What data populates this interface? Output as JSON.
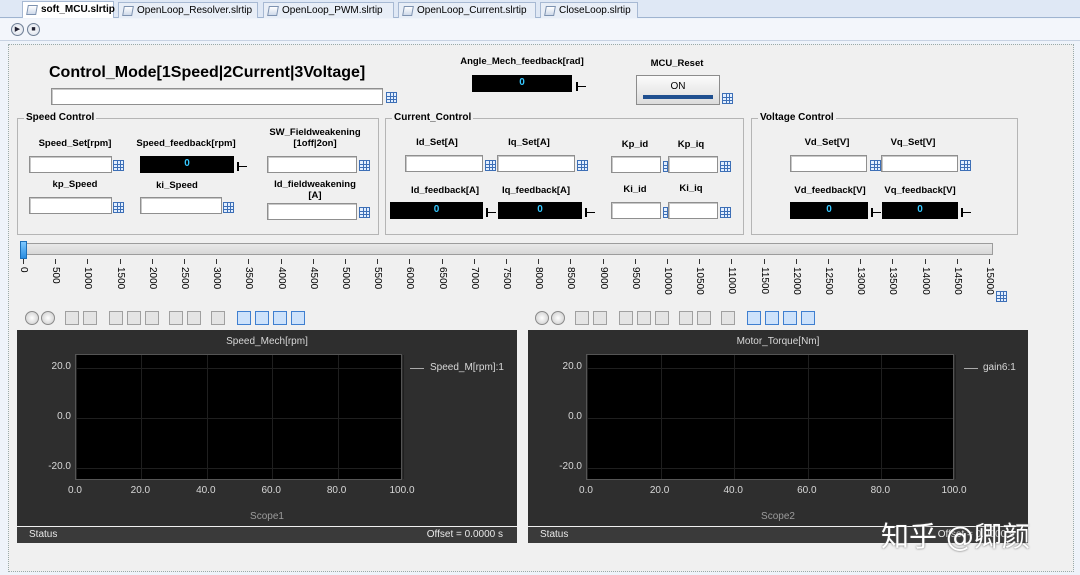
{
  "tabs": [
    {
      "label": "soft_MCU.slrtip",
      "active": true
    },
    {
      "label": "OpenLoop_Resolver.slrtip",
      "active": false
    },
    {
      "label": "OpenLoop_PWM.slrtip",
      "active": false
    },
    {
      "label": "OpenLoop_Current.slrtip",
      "active": false
    },
    {
      "label": "CloseLoop.slrtip",
      "active": false
    }
  ],
  "header": {
    "control_mode_title": "Control_Mode[1Speed|2Current|3Voltage]",
    "angle_label": "Angle_Mech_feedback[rad]",
    "angle_value": "0",
    "mcu_reset_label": "MCU_Reset",
    "mcu_reset_button": "ON"
  },
  "speed_control": {
    "title": "Speed Control",
    "speed_set_label": "Speed_Set[rpm]",
    "speed_feedback_label": "Speed_feedback[rpm]",
    "speed_feedback_value": "0",
    "sw_fieldweakening_label_1": "SW_Fieldweakening",
    "sw_fieldweakening_label_2": "[1off|2on]",
    "kp_speed_label": "kp_Speed",
    "ki_speed_label": "ki_Speed",
    "id_fieldweakening_label_1": "Id_fieldweakening",
    "id_fieldweakening_label_2": "[A]"
  },
  "current_control": {
    "title": "Current_Control",
    "id_set_label": "Id_Set[A]",
    "iq_set_label": "Iq_Set[A]",
    "kp_id_label": "Kp_id",
    "kp_iq_label": "Kp_iq",
    "id_feedback_label": "Id_feedback[A]",
    "id_feedback_value": "0",
    "iq_feedback_label": "Iq_feedback[A]",
    "iq_feedback_value": "0",
    "ki_id_label": "Ki_id",
    "ki_iq_label": "Ki_iq"
  },
  "voltage_control": {
    "title": "Voltage Control",
    "vd_set_label": "Vd_Set[V]",
    "vq_set_label": "Vq_Set[V]",
    "vd_feedback_label": "Vd_feedback[V]",
    "vd_feedback_value": "0",
    "vq_feedback_label": "Vq_feedback[V]",
    "vq_feedback_value": "0"
  },
  "slider": {
    "value": 0,
    "min": 0,
    "max": 15000,
    "tick_labels": [
      "0",
      "500",
      "1000",
      "1500",
      "2000",
      "2500",
      "3000",
      "3500",
      "4000",
      "4500",
      "5000",
      "5500",
      "6000",
      "6500",
      "7000",
      "7500",
      "8000",
      "8500",
      "9000",
      "9500",
      "10000",
      "10500",
      "11000",
      "11500",
      "12000",
      "12500",
      "13000",
      "13500",
      "14000",
      "14500",
      "15000"
    ]
  },
  "scopes": [
    {
      "title": "Speed_Mech[rpm]",
      "legend": "Speed_M[rpm]:1",
      "name": "Scope1",
      "y_ticks": [
        "20.0",
        "0.0",
        "-20.0"
      ],
      "x_ticks": [
        "0.0",
        "20.0",
        "40.0",
        "60.0",
        "80.0",
        "100.0"
      ],
      "status_label": "Status",
      "status_offset": "Offset = 0.0000 s"
    },
    {
      "title": "Motor_Torque[Nm]",
      "legend": "gain6:1",
      "name": "Scope2",
      "y_ticks": [
        "20.0",
        "0.0",
        "-20.0"
      ],
      "x_ticks": [
        "0.0",
        "20.0",
        "40.0",
        "60.0",
        "80.0",
        "100.0"
      ],
      "status_label": "Status",
      "status_offset": "Offset = 0.0000 s"
    }
  ],
  "chart_data": [
    {
      "type": "line",
      "title": "Speed_Mech[rpm]",
      "xlabel": "",
      "ylabel": "",
      "xlim": [
        0,
        100
      ],
      "ylim": [
        -25,
        25
      ],
      "x_ticks": [
        0,
        20,
        40,
        60,
        80,
        100
      ],
      "y_ticks": [
        -20,
        0,
        20
      ],
      "grid": true,
      "legend_position": "top-right",
      "series": [
        {
          "name": "Speed_M[rpm]:1",
          "x": [],
          "y": []
        }
      ]
    },
    {
      "type": "line",
      "title": "Motor_Torque[Nm]",
      "xlabel": "",
      "ylabel": "",
      "xlim": [
        0,
        100
      ],
      "ylim": [
        -25,
        25
      ],
      "x_ticks": [
        0,
        20,
        40,
        60,
        80,
        100
      ],
      "y_ticks": [
        -20,
        0,
        20
      ],
      "grid": true,
      "legend_position": "top-right",
      "series": [
        {
          "name": "gain6:1",
          "x": [],
          "y": []
        }
      ]
    }
  ],
  "watermark": "知乎 @卿颜"
}
